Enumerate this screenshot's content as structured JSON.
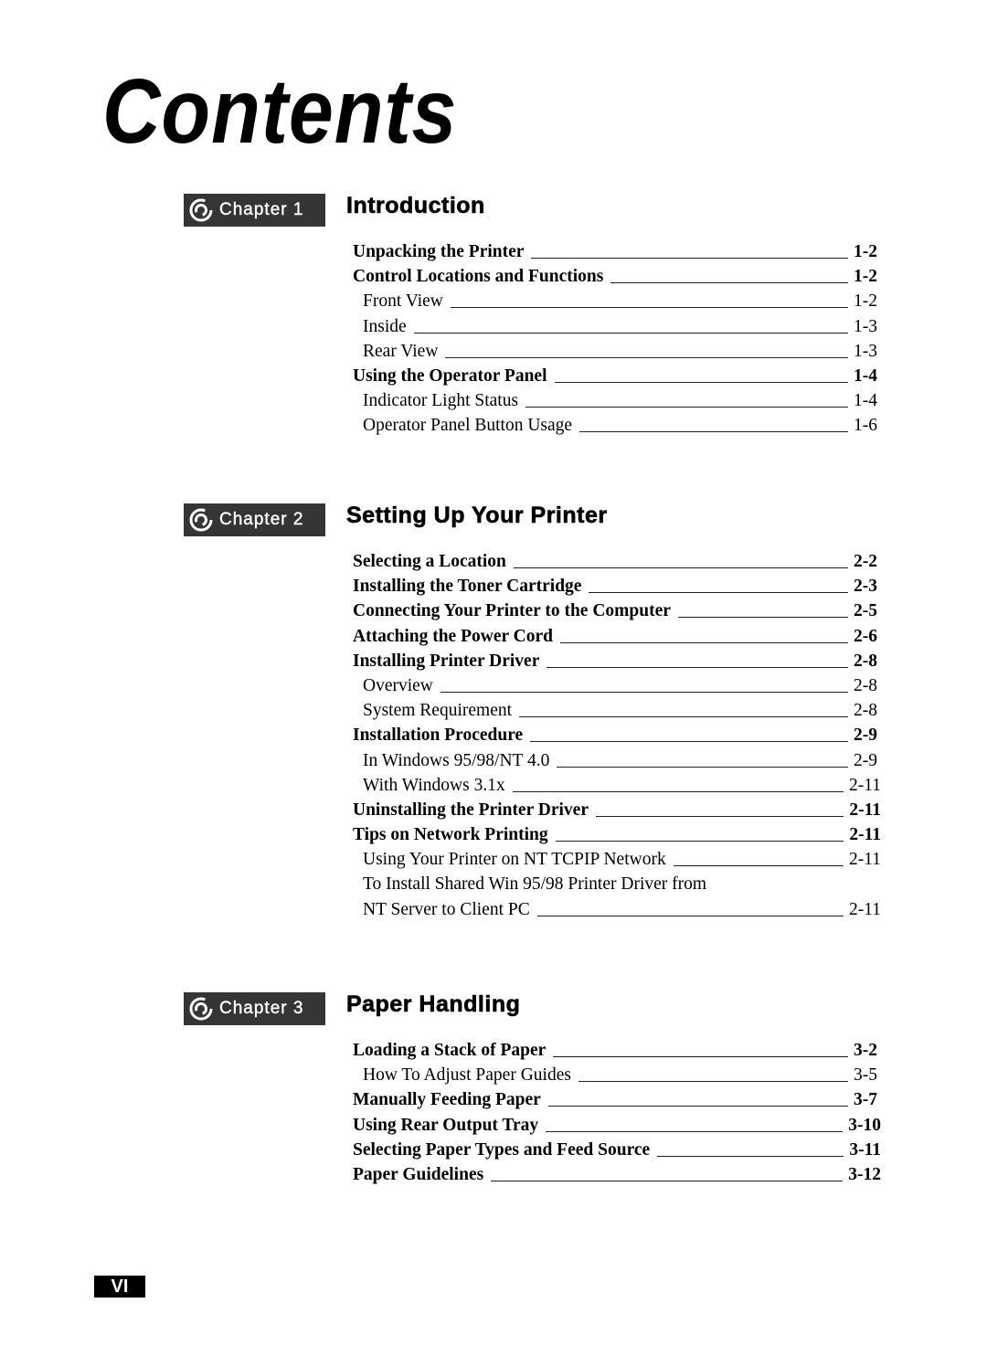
{
  "title": "Contents",
  "chapters": [
    {
      "badge_label": "Chapter 1",
      "title": "Introduction",
      "entries": [
        {
          "label": "Unpacking the Printer",
          "page": "1-2",
          "level": "main"
        },
        {
          "label": "Control Locations and Functions",
          "page": "1-2",
          "level": "main"
        },
        {
          "label": "Front View",
          "page": "1-2",
          "level": "sub"
        },
        {
          "label": "Inside",
          "page": "1-3",
          "level": "sub"
        },
        {
          "label": "Rear View",
          "page": "1-3",
          "level": "sub"
        },
        {
          "label": "Using the Operator Panel",
          "page": "1-4",
          "level": "main"
        },
        {
          "label": "Indicator Light Status",
          "page": "1-4",
          "level": "sub"
        },
        {
          "label": "Operator Panel Button Usage",
          "page": "1-6",
          "level": "sub"
        }
      ]
    },
    {
      "badge_label": "Chapter 2",
      "title": "Setting Up Your Printer",
      "entries": [
        {
          "label": "Selecting a Location",
          "page": "2-2",
          "level": "main"
        },
        {
          "label": "Installing the Toner Cartridge",
          "page": "2-3",
          "level": "main"
        },
        {
          "label": "Connecting Your Printer to the Computer",
          "page": "2-5",
          "level": "main"
        },
        {
          "label": "Attaching the Power Cord",
          "page": "2-6",
          "level": "main"
        },
        {
          "label": "Installing Printer Driver",
          "page": "2-8",
          "level": "main"
        },
        {
          "label": "Overview",
          "page": "2-8",
          "level": "sub"
        },
        {
          "label": "System Requirement",
          "page": "2-8",
          "level": "sub"
        },
        {
          "label": "Installation Procedure",
          "page": "2-9",
          "level": "main"
        },
        {
          "label": "In Windows 95/98/NT 4.0",
          "page": "2-9",
          "level": "sub"
        },
        {
          "label": "With Windows 3.1x",
          "page": "2-11",
          "level": "sub"
        },
        {
          "label": "Uninstalling the Printer Driver",
          "page": "2-11",
          "level": "main"
        },
        {
          "label": "Tips on Network Printing",
          "page": "2-11",
          "level": "main"
        },
        {
          "label": "Using Your Printer on NT TCPIP Network",
          "page": "2-11",
          "level": "sub"
        },
        {
          "label": "To Install Shared Win 95/98 Printer Driver from",
          "page": "",
          "level": "sub"
        },
        {
          "label": "NT Server to Client PC",
          "page": "2-11",
          "level": "sub"
        }
      ]
    },
    {
      "badge_label": "Chapter 3",
      "title": "Paper Handling",
      "entries": [
        {
          "label": "Loading a Stack of Paper",
          "page": "3-2",
          "level": "main"
        },
        {
          "label": "How To Adjust Paper Guides",
          "page": "3-5",
          "level": "sub"
        },
        {
          "label": "Manually Feeding Paper",
          "page": "3-7",
          "level": "main"
        },
        {
          "label": "Using Rear Output Tray",
          "page": "3-10",
          "level": "main"
        },
        {
          "label": "Selecting Paper Types and Feed Source",
          "page": "3-11",
          "level": "main"
        },
        {
          "label": "Paper Guidelines",
          "page": "3-12",
          "level": "main"
        }
      ]
    }
  ],
  "page_number": "VI",
  "colors": {
    "badge_bg": "#353535",
    "text": "#000000"
  }
}
